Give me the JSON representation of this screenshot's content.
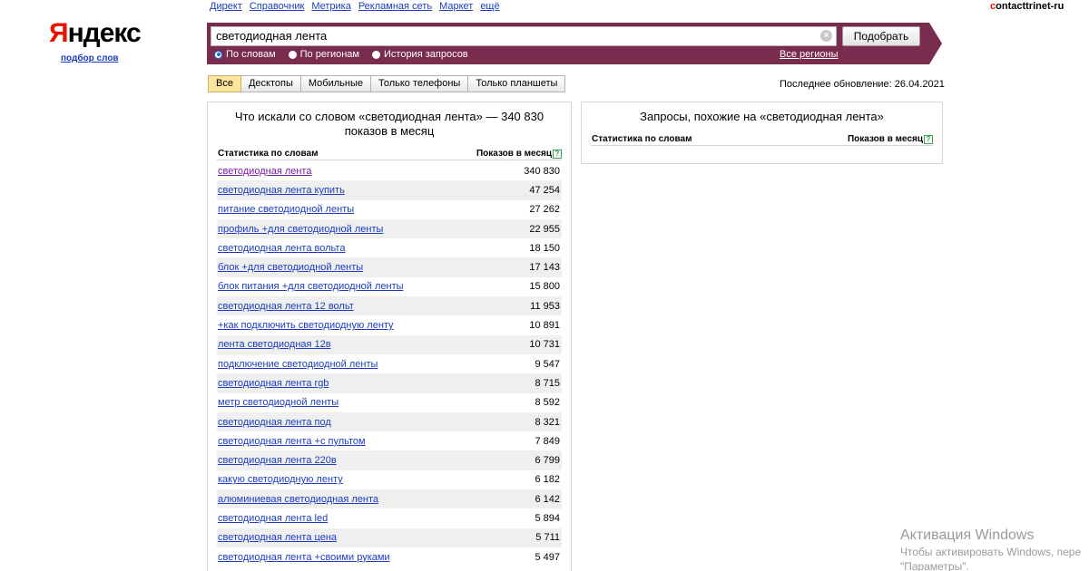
{
  "logo": {
    "first": "Я",
    "rest": "ндекс",
    "sub": "подбор слов"
  },
  "topnav": [
    "Директ",
    "Справочник",
    "Метрика",
    "Рекламная сеть",
    "Маркет",
    "ещё"
  ],
  "user": {
    "first": "c",
    "rest": "ontacttrinet-ru"
  },
  "search": {
    "value": "светодиодная лента",
    "button": "Подобрать",
    "clear": "×"
  },
  "modes": [
    {
      "label": "По словам",
      "active": true
    },
    {
      "label": "По регионам",
      "active": false
    },
    {
      "label": "История запросов",
      "active": false
    }
  ],
  "all_regions": "Все регионы",
  "device_tabs": [
    "Все",
    "Десктопы",
    "Мобильные",
    "Только телефоны",
    "Только планшеты"
  ],
  "updated": "Последнее обновление: 26.04.2021",
  "left_panel": {
    "title": "Что искали со словом «светодиодная лента» — 340 830 показов в месяц",
    "col_words": "Статистика по словам",
    "col_count": "Показов в месяц",
    "help": "?",
    "rows": [
      {
        "q": "светодиодная лента",
        "n": "340 830",
        "visited": true
      },
      {
        "q": "светодиодная лента купить",
        "n": "47 254"
      },
      {
        "q": "питание светодиодной ленты",
        "n": "27 262"
      },
      {
        "q": "профиль +для светодиодной ленты",
        "n": "22 955"
      },
      {
        "q": "светодиодная лента вольта",
        "n": "18 150"
      },
      {
        "q": "блок +для светодиодной ленты",
        "n": "17 143"
      },
      {
        "q": "блок питания +для светодиодной ленты",
        "n": "15 800"
      },
      {
        "q": "светодиодная лента 12 вольт",
        "n": "11 953"
      },
      {
        "q": "+как подключить светодиодную ленту",
        "n": "10 891"
      },
      {
        "q": "лента светодиодная 12в",
        "n": "10 731"
      },
      {
        "q": "подключение светодиодной ленты",
        "n": "9 547"
      },
      {
        "q": "светодиодная лента rgb",
        "n": "8 715"
      },
      {
        "q": "метр светодиодной ленты",
        "n": "8 592"
      },
      {
        "q": "светодиодная лента под",
        "n": "8 321"
      },
      {
        "q": "светодиодная лента +с пультом",
        "n": "7 849"
      },
      {
        "q": "светодиодная лента 220в",
        "n": "6 799"
      },
      {
        "q": "какую светодиодную ленту",
        "n": "6 182"
      },
      {
        "q": "алюминиевая светодиодная лента",
        "n": "6 142"
      },
      {
        "q": "светодиодная лента led",
        "n": "5 894"
      },
      {
        "q": "светодиодная лента цена",
        "n": "5 711"
      },
      {
        "q": "светодиодная лента +своими руками",
        "n": "5 497"
      }
    ]
  },
  "right_panel": {
    "title": "Запросы, похожие на «светодиодная лента»",
    "col_words": "Статистика по словам",
    "col_count": "Показов в месяц",
    "help": "?"
  },
  "watermark": {
    "line1": "Активация Windows",
    "line2": "Чтобы активировать Windows, пере",
    "line3": "\"Параметры\"."
  }
}
